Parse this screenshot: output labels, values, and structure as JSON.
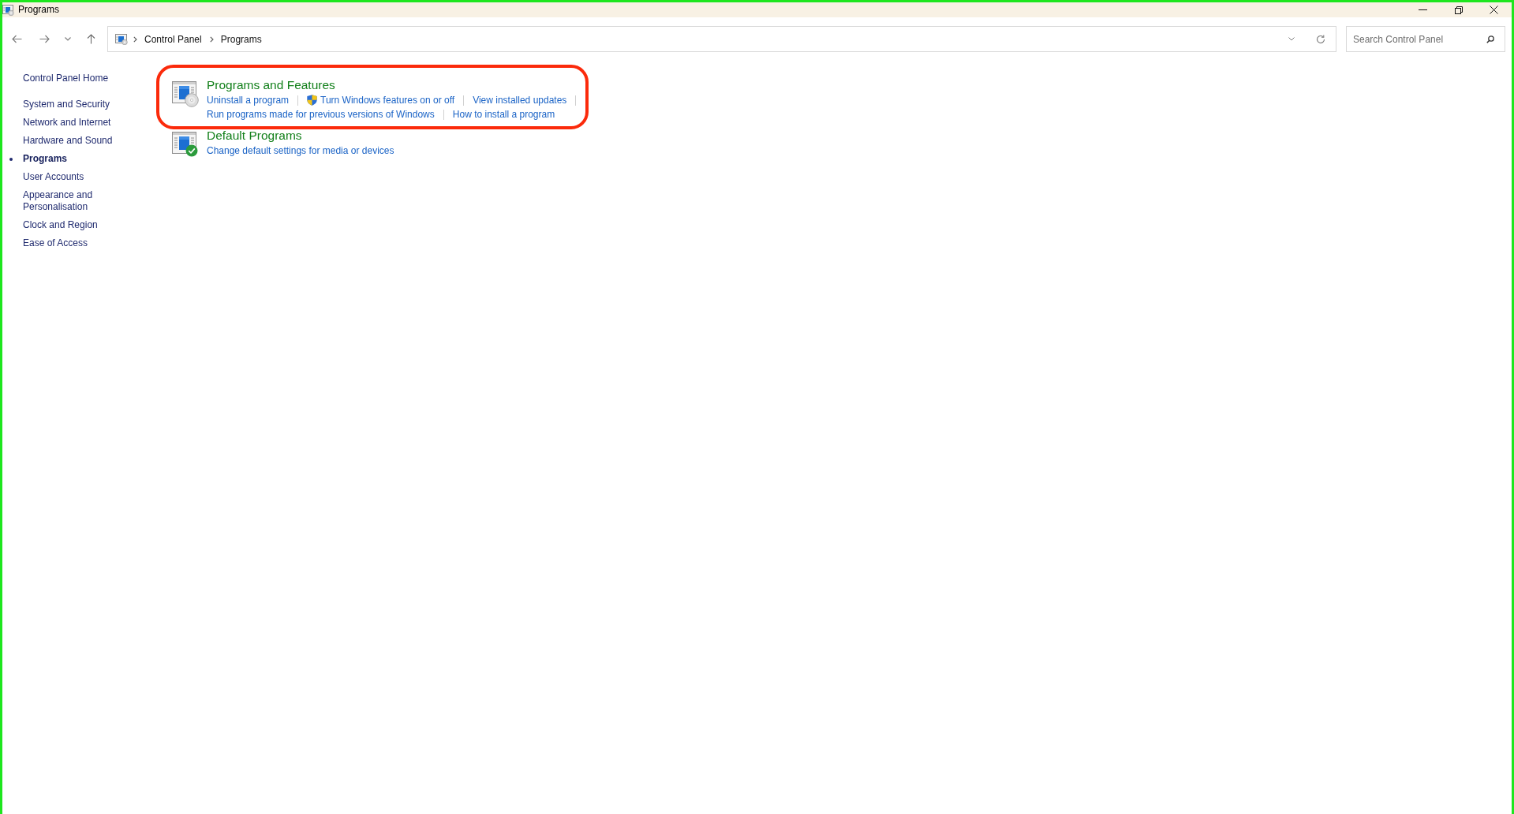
{
  "window": {
    "title": "Programs"
  },
  "address_bar": {
    "breadcrumbs": [
      "Control Panel",
      "Programs"
    ]
  },
  "search": {
    "placeholder": "Search Control Panel"
  },
  "sidebar": {
    "home": "Control Panel Home",
    "items": [
      {
        "label": "System and Security",
        "selected": false
      },
      {
        "label": "Network and Internet",
        "selected": false
      },
      {
        "label": "Hardware and Sound",
        "selected": false
      },
      {
        "label": "Programs",
        "selected": true
      },
      {
        "label": "User Accounts",
        "selected": false
      },
      {
        "label": "Appearance and Personalisation",
        "selected": false
      },
      {
        "label": "Clock and Region",
        "selected": false
      },
      {
        "label": "Ease of Access",
        "selected": false
      }
    ]
  },
  "categories": [
    {
      "title": "Programs and Features",
      "kind": "disc",
      "highlighted": true,
      "link_rows": [
        [
          {
            "label": "Uninstall a program",
            "shield": false
          },
          {
            "label": "Turn Windows features on or off",
            "shield": true
          },
          {
            "label": "View installed updates",
            "shield": false
          }
        ],
        [
          {
            "label": "Run programs made for previous versions of Windows",
            "shield": false
          },
          {
            "label": "How to install a program",
            "shield": false
          }
        ]
      ]
    },
    {
      "title": "Default Programs",
      "kind": "check",
      "highlighted": false,
      "link_rows": [
        [
          {
            "label": "Change default settings for media or devices",
            "shield": false
          }
        ]
      ]
    }
  ]
}
